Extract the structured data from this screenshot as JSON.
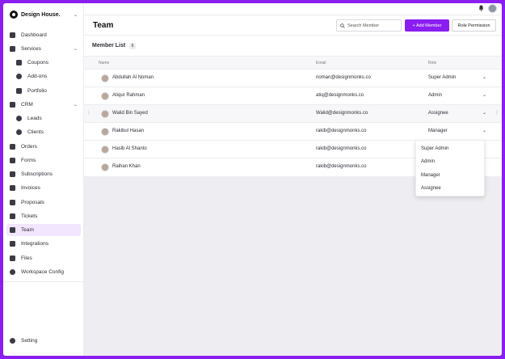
{
  "brand": {
    "name": "Design House."
  },
  "sidebar": {
    "items": [
      {
        "label": "Dashboard"
      },
      {
        "label": "Services"
      },
      {
        "label": "Coupons"
      },
      {
        "label": "Add-ons"
      },
      {
        "label": "Portfolio"
      },
      {
        "label": "CRM"
      },
      {
        "label": "Leads"
      },
      {
        "label": "Clients"
      },
      {
        "label": "Orders"
      },
      {
        "label": "Forms"
      },
      {
        "label": "Subscriptions"
      },
      {
        "label": "Invoices"
      },
      {
        "label": "Proposals"
      },
      {
        "label": "Tickets"
      },
      {
        "label": "Team"
      },
      {
        "label": "Integrations"
      },
      {
        "label": "Files"
      },
      {
        "label": "Workspace Config"
      }
    ],
    "setting_label": "Setting"
  },
  "header": {
    "title": "Team",
    "search_placeholder": "Search Member",
    "add_member_label": "+ Add Member",
    "role_permission_label": "Role Permission"
  },
  "member_list": {
    "title": "Member List",
    "count": "6",
    "columns": {
      "name": "Name",
      "email": "Email",
      "role": "Role"
    },
    "rows": [
      {
        "name": "Abdullah Al Noman",
        "email": "noman@designmonks.co",
        "role": "Super Admin"
      },
      {
        "name": "Atiqur Rahman",
        "email": "atiq@designmonks.co",
        "role": "Admin"
      },
      {
        "name": "Walid Bin Sayed",
        "email": "Walid@designmonks.co",
        "role": "Assignee"
      },
      {
        "name": "Rakibul Hasan",
        "email": "rakib@designmonks.co",
        "role": "Manager"
      },
      {
        "name": "Hasib Al Shanto",
        "email": "rakib@designmonks.co",
        "role": ""
      },
      {
        "name": "Raihan Khan",
        "email": "rakib@designmonks.co",
        "role": ""
      }
    ]
  },
  "role_dropdown": {
    "options": [
      "Super Admin",
      "Admin",
      "Manager",
      "Assignee"
    ]
  },
  "colors": {
    "accent": "#8a1ef0",
    "active_bg": "#f1e6fd"
  }
}
